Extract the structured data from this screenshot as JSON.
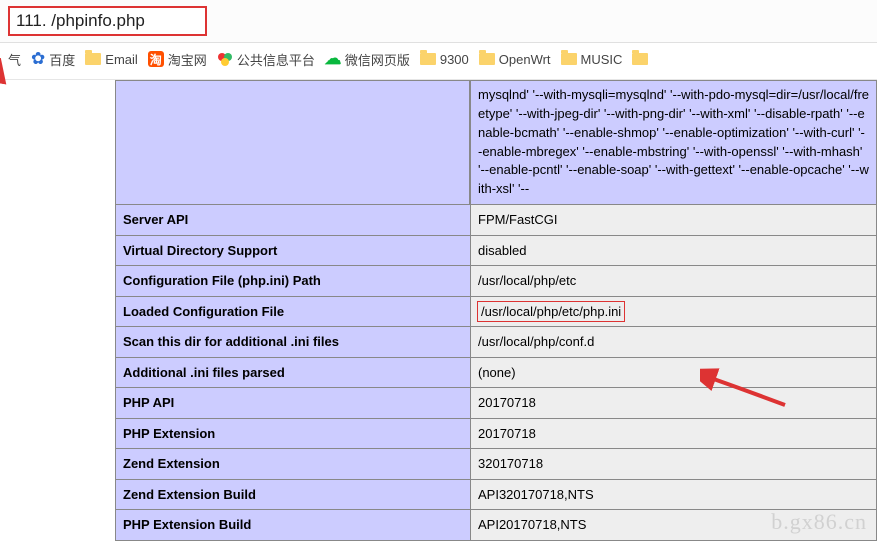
{
  "address_bar": {
    "url": "111.          /phpinfo.php"
  },
  "bookmarks": {
    "weather": "气",
    "baidu": "百度",
    "email": "Email",
    "taobao": "淘宝网",
    "pubinfo": "公共信息平台",
    "wechat": "微信网页版",
    "f9300": "9300",
    "openwrt": "OpenWrt",
    "music": "MUSIC"
  },
  "configure_command": "mysqlnd' '--with-mysqli=mysqlnd' '--with-pdo-mysql=dir=/usr/local/freetype' '--with-jpeg-dir' '--with-png-dir' '--with-xml' '--disable-rpath' '--enable-bcmath' '--enable-shmop' '--enable-optimization' '--with-curl' '--enable-mbregex' '--enable-mbstring' '--with-openssl' '--with-mhash' '--enable-pcntl' '--enable-soap' '--with-gettext' '--enable-opcache' '--with-xsl' '--",
  "rows": [
    {
      "k": "Server API",
      "v": "FPM/FastCGI"
    },
    {
      "k": "Virtual Directory Support",
      "v": "disabled"
    },
    {
      "k": "Configuration File (php.ini) Path",
      "v": "/usr/local/php/etc"
    },
    {
      "k": "Loaded Configuration File",
      "v": "/usr/local/php/etc/php.ini"
    },
    {
      "k": "Scan this dir for additional .ini files",
      "v": "/usr/local/php/conf.d"
    },
    {
      "k": "Additional .ini files parsed",
      "v": "(none)"
    },
    {
      "k": "PHP API",
      "v": "20170718"
    },
    {
      "k": "PHP Extension",
      "v": "20170718"
    },
    {
      "k": "Zend Extension",
      "v": "320170718"
    },
    {
      "k": "Zend Extension Build",
      "v": "API320170718,NTS"
    },
    {
      "k": "PHP Extension Build",
      "v": "API20170718,NTS"
    }
  ],
  "watermark": "b.gx86.cn"
}
